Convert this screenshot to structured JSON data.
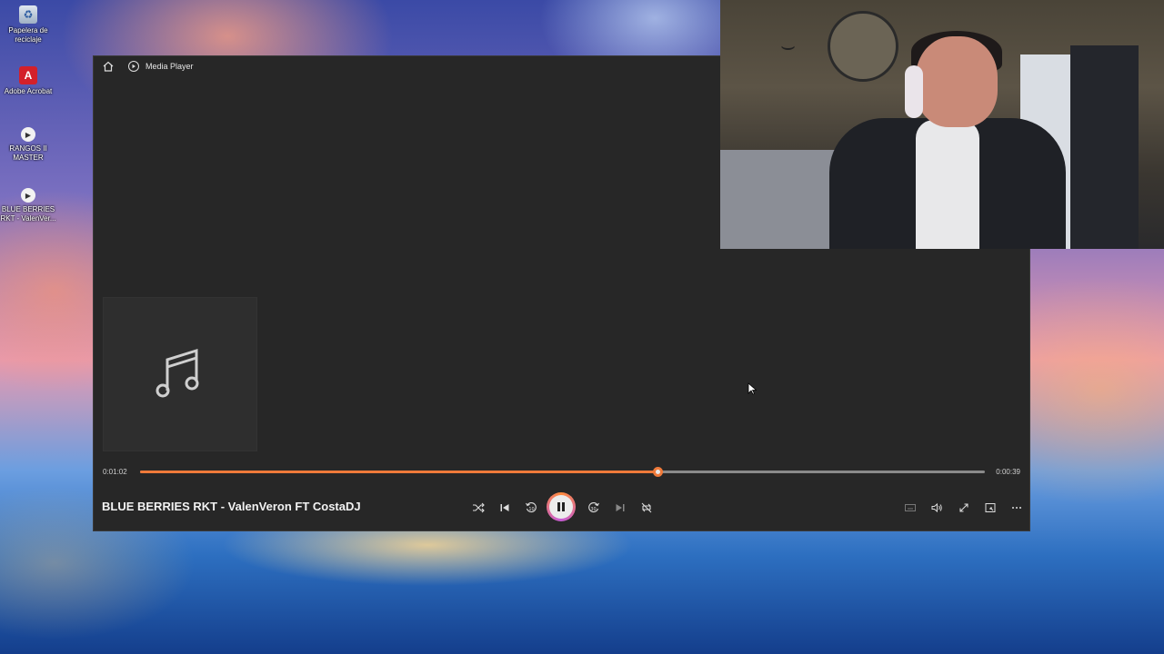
{
  "desktop": {
    "icons": [
      {
        "label": "Papelera de\nreciclaje",
        "icon": "recycle-bin-icon"
      },
      {
        "label": "Adobe Acrobat",
        "icon": "pdf-icon"
      },
      {
        "label": "RANGOS II\nMASTER",
        "icon": "media-file-icon"
      },
      {
        "label": "BLUE BERRIES\nRKT - ValenVer...",
        "icon": "media-file-icon"
      }
    ]
  },
  "player": {
    "app_title": "Media Player",
    "song_title": "BLUE BERRIES RKT - ValenVeron FT CostaDJ",
    "elapsed": "0:01:02",
    "remaining": "0:00:39",
    "progress_fraction": 0.612,
    "state": "playing",
    "skip_back_seconds": "10",
    "skip_forward_seconds": "30",
    "accent_color": "#ef7a3a"
  }
}
